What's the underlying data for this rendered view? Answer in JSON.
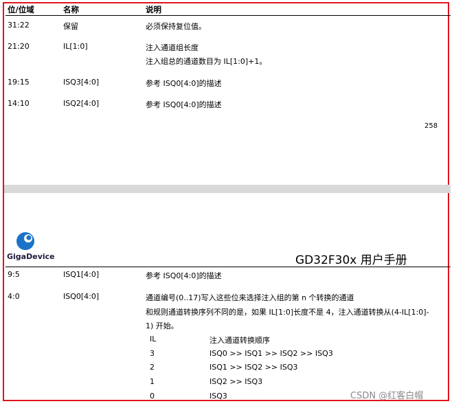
{
  "header": {
    "col_bits": "位/位域",
    "col_name": "名称",
    "col_desc": "说明"
  },
  "rows_top": [
    {
      "bits": "31:22",
      "name": "保留",
      "desc": [
        "必须保持复位值。"
      ]
    },
    {
      "bits": "21:20",
      "name": "IL[1:0]",
      "desc": [
        "注入通道组长度",
        "注入组总的通道数目为 IL[1:0]+1。"
      ]
    },
    {
      "bits": "19:15",
      "name": "ISQ3[4:0]",
      "desc": [
        "参考 ISQ0[4:0]的描述"
      ]
    },
    {
      "bits": "14:10",
      "name": "ISQ2[4:0]",
      "desc": [
        "参考 ISQ0[4:0]的描述"
      ]
    }
  ],
  "page_number": "258",
  "logo": {
    "text": "GigaDevice",
    "color": "#1a73c8"
  },
  "doc_title": "GD32F30x 用户手册",
  "rows_bottom": [
    {
      "bits": "9:5",
      "name": "ISQ1[4:0]",
      "desc": [
        "参考 ISQ0[4:0]的描述"
      ]
    },
    {
      "bits": "4:0",
      "name": "ISQ0[4:0]",
      "desc": [
        "通道编号(0..17)写入这些位来选择注入组的第 n 个转换的通道",
        "和规则通道转换序列不同的是，如果 IL[1:0]长度不是 4，注入通道转换从(4-IL[1:0]-",
        "1) 开始。"
      ]
    }
  ],
  "sub_table": {
    "header": {
      "il": "IL",
      "order": "注入通道转换顺序"
    },
    "rows": [
      {
        "il": "3",
        "order": "ISQ0 >> ISQ1 >> ISQ2 >> ISQ3"
      },
      {
        "il": "2",
        "order": "ISQ1 >> ISQ2 >> ISQ3"
      },
      {
        "il": "1",
        "order": "ISQ2 >> ISQ3"
      },
      {
        "il": "0",
        "order": "ISQ3"
      }
    ]
  },
  "watermark": "CSDN @红客白帽",
  "colors": {
    "border": "#e0131b",
    "separator": "#d9d9d9"
  }
}
